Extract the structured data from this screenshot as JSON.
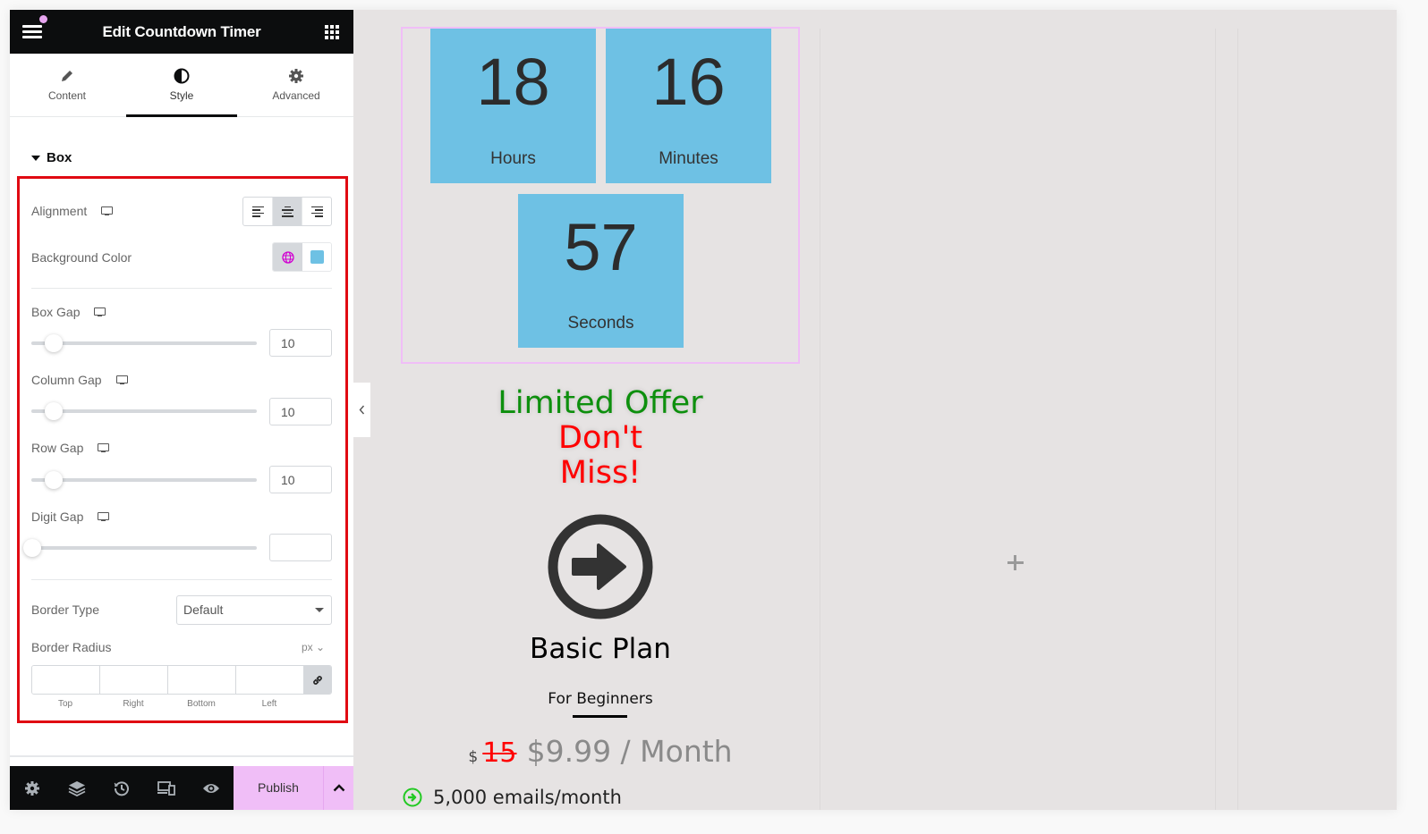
{
  "header": {
    "title": "Edit Countdown Timer"
  },
  "tabs": [
    {
      "label": "Content",
      "icon": "pencil-icon"
    },
    {
      "label": "Style",
      "icon": "contrast-icon",
      "active": true
    },
    {
      "label": "Advanced",
      "icon": "gear-icon"
    }
  ],
  "section": {
    "title": "Box"
  },
  "controls": {
    "alignment": {
      "label": "Alignment",
      "options": [
        "left",
        "center",
        "right"
      ],
      "selected": "center"
    },
    "background_color": {
      "label": "Background Color",
      "value": "#6ec1e4"
    },
    "box_gap": {
      "label": "Box Gap",
      "value": "10"
    },
    "column_gap": {
      "label": "Column Gap",
      "value": "10"
    },
    "row_gap": {
      "label": "Row Gap",
      "value": "10"
    },
    "digit_gap": {
      "label": "Digit Gap",
      "value": ""
    },
    "border_type": {
      "label": "Border Type",
      "value": "Default"
    },
    "border_radius": {
      "label": "Border Radius",
      "unit": "px",
      "fields": [
        "Top",
        "Right",
        "Bottom",
        "Left"
      ]
    }
  },
  "footer": {
    "publish_label": "Publish",
    "icons": [
      "settings-icon",
      "layers-icon",
      "history-icon",
      "responsive-icon",
      "preview-icon"
    ]
  },
  "canvas": {
    "timer": [
      {
        "value": "18",
        "label": "Hours"
      },
      {
        "value": "16",
        "label": "Minutes"
      },
      {
        "value": "57",
        "label": "Seconds"
      }
    ],
    "offer_line1": "Limited Offer",
    "offer_line2": "Don't",
    "offer_line3": "Miss!",
    "plan_title": "Basic Plan",
    "plan_subtitle": "For Beginners",
    "price_currency": "$",
    "price_old": "15",
    "price_new": "$9.99 / Month",
    "feature": "5,000 emails/month"
  },
  "colors": {
    "accent": "#f0bef7",
    "highlight": "#e00a12",
    "timer_box": "#6ec1e4",
    "offer_green": "#0d8f0d",
    "offer_red": "#ff0000"
  }
}
